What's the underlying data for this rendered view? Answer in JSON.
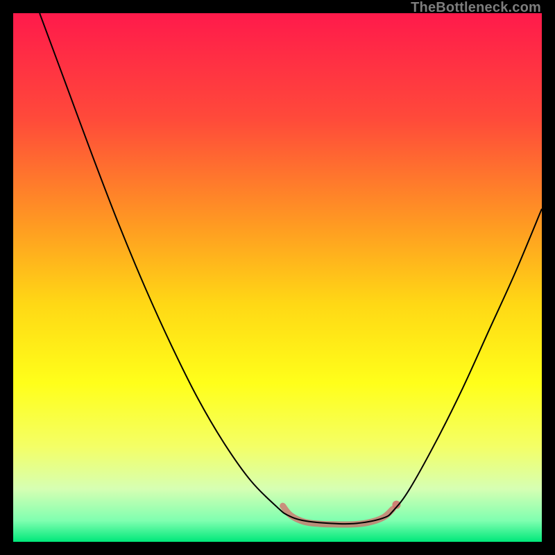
{
  "watermark": "TheBottleneck.com",
  "chart_data": {
    "type": "line",
    "title": "",
    "xlabel": "",
    "ylabel": "",
    "xlim": [
      0,
      100
    ],
    "ylim": [
      0,
      100
    ],
    "background_gradient": {
      "stops": [
        {
          "offset": 0.0,
          "color": "#ff1a4b"
        },
        {
          "offset": 0.2,
          "color": "#ff4a3a"
        },
        {
          "offset": 0.4,
          "color": "#ff9a22"
        },
        {
          "offset": 0.55,
          "color": "#ffd815"
        },
        {
          "offset": 0.7,
          "color": "#ffff1a"
        },
        {
          "offset": 0.82,
          "color": "#f4ff66"
        },
        {
          "offset": 0.9,
          "color": "#d6ffb3"
        },
        {
          "offset": 0.96,
          "color": "#7fffb0"
        },
        {
          "offset": 1.0,
          "color": "#00e87a"
        }
      ]
    },
    "series": [
      {
        "name": "bottleneck-curve",
        "color": "#000000",
        "width": 2,
        "points": [
          {
            "x": 5.0,
            "y": 100.0
          },
          {
            "x": 10.0,
            "y": 86.5
          },
          {
            "x": 15.0,
            "y": 73.0
          },
          {
            "x": 20.0,
            "y": 60.0
          },
          {
            "x": 25.0,
            "y": 48.0
          },
          {
            "x": 30.0,
            "y": 37.0
          },
          {
            "x": 35.0,
            "y": 27.0
          },
          {
            "x": 40.0,
            "y": 18.5
          },
          {
            "x": 45.0,
            "y": 11.5
          },
          {
            "x": 50.0,
            "y": 6.5
          },
          {
            "x": 52.0,
            "y": 5.0
          },
          {
            "x": 55.0,
            "y": 4.0
          },
          {
            "x": 60.0,
            "y": 3.5
          },
          {
            "x": 65.0,
            "y": 3.5
          },
          {
            "x": 70.0,
            "y": 4.5
          },
          {
            "x": 72.0,
            "y": 6.0
          },
          {
            "x": 75.0,
            "y": 10.0
          },
          {
            "x": 80.0,
            "y": 19.0
          },
          {
            "x": 85.0,
            "y": 29.0
          },
          {
            "x": 90.0,
            "y": 40.0
          },
          {
            "x": 95.0,
            "y": 51.0
          },
          {
            "x": 100.0,
            "y": 63.0
          }
        ]
      },
      {
        "name": "optimal-band-marker",
        "color": "#d46a6a",
        "width": 9,
        "opacity": 0.75,
        "points": [
          {
            "x": 51.0,
            "y": 6.8
          },
          {
            "x": 52.5,
            "y": 5.0
          },
          {
            "x": 55.0,
            "y": 3.8
          },
          {
            "x": 58.0,
            "y": 3.4
          },
          {
            "x": 61.0,
            "y": 3.3
          },
          {
            "x": 64.0,
            "y": 3.3
          },
          {
            "x": 67.0,
            "y": 3.6
          },
          {
            "x": 70.0,
            "y": 4.6
          },
          {
            "x": 71.8,
            "y": 6.2
          }
        ]
      },
      {
        "name": "marker-dot",
        "type": "scatter",
        "color": "#d46a6a",
        "radius": 6,
        "points": [
          {
            "x": 72.5,
            "y": 7.0
          }
        ]
      }
    ]
  }
}
